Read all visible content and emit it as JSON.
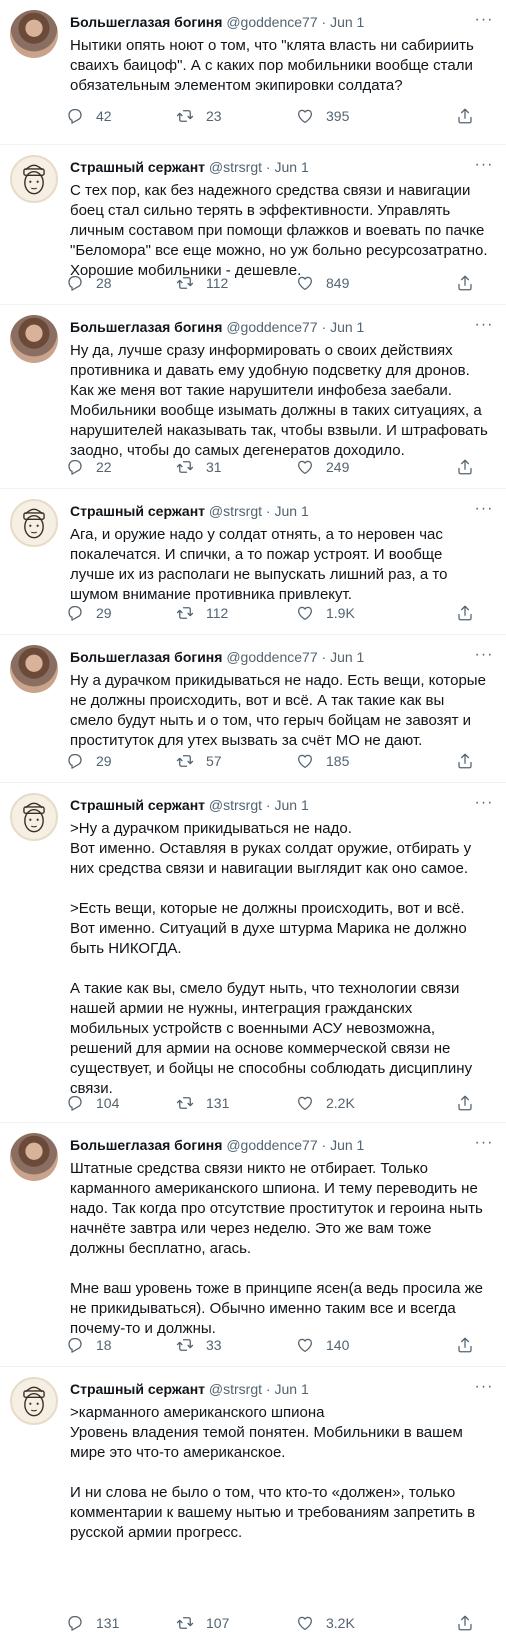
{
  "thread": {
    "tweets": [
      {
        "author": "Большеглазая богиня",
        "handle": "@goddence77",
        "separator": "·",
        "date": "Jun 1",
        "avatar": "goddess-avatar",
        "text": "Нытики опять ноют о том, что \"клята власть ни сабириить сваихъ баицоф\". А с каких пор мобильники вообще стали обязательным элементом экипировки солдата?",
        "replies": "42",
        "retweets": "23",
        "likes": "395"
      },
      {
        "author": "Страшный сержант",
        "handle": "@strsrgt",
        "separator": "·",
        "date": "Jun 1",
        "avatar": "sergeant-avatar",
        "text": "С тех пор, как без надежного средства связи и навигации боец стал сильно терять в эффективности. Управлять личным составом при помощи флажков и воевать по пачке \"Беломора\" все еще можно, но уж больно ресурсозатратно. Хорошие мобильники - дешевле.",
        "replies": "28",
        "retweets": "112",
        "likes": "849"
      },
      {
        "author": "Большеглазая богиня",
        "handle": "@goddence77",
        "separator": "·",
        "date": "Jun 1",
        "avatar": "goddess-avatar",
        "text": "Ну да, лучше сразу информировать о своих действиях противника и давать ему удобную подсветку для дронов. Как же меня вот такие нарушители инфобеза заебали. Мобильники вообще изымать должны в таких ситуациях, а нарушителей наказывать так, чтобы взвыли. И штрафовать заодно, чтобы до самых дегенератов доходило.",
        "replies": "22",
        "retweets": "31",
        "likes": "249"
      },
      {
        "author": "Страшный сержант",
        "handle": "@strsrgt",
        "separator": "·",
        "date": "Jun 1",
        "avatar": "sergeant-avatar",
        "text": "Ага, и оружие надо у солдат отнять, а то неровен час покалечатся. И спички, а то пожар устроят. И вообще лучше их из располаги не выпускать лишний раз, а то шумом внимание противника привлекут.",
        "replies": "29",
        "retweets": "112",
        "likes": "1.9K"
      },
      {
        "author": "Большеглазая богиня",
        "handle": "@goddence77",
        "separator": "·",
        "date": "Jun 1",
        "avatar": "goddess-avatar",
        "text": "Ну а дурачком прикидываться не надо. Есть вещи, которые не должны происходить, вот и всё. А так такие как вы смело будут ныть и о том, что герыч бойцам не завозят и проституток для утех вызвать за счёт МО не дают.",
        "replies": "29",
        "retweets": "57",
        "likes": "185"
      },
      {
        "author": "Страшный сержант",
        "handle": "@strsrgt",
        "separator": "·",
        "date": "Jun 1",
        "avatar": "sergeant-avatar",
        "text": ">Ну а дурачком прикидываться не надо.\nВот именно. Оставляя в руках солдат оружие, отбирать у них средства связи и навигации выглядит как оно самое.\n\n>Есть вещи, которые не должны происходить, вот и всё.\nВот именно. Ситуаций в духе штурма Марика не должно быть НИКОГДА.\n\nА такие как вы, смело будут ныть, что технологии связи нашей армии не нужны, интеграция гражданских мобильных устройств с военными АСУ невозможна, решений для армии на основе коммерческой связи не существует, и бойцы не способны соблюдать дисциплину связи.",
        "replies": "104",
        "retweets": "131",
        "likes": "2.2K"
      },
      {
        "author": "Большеглазая богиня",
        "handle": "@goddence77",
        "separator": "·",
        "date": "Jun 1",
        "avatar": "goddess-avatar",
        "text": "Штатные средства связи никто не отбирает. Только карманного американского шпиона. И тему переводить не надо. Так когда про отсутствие проституток и героина ныть начнёте завтра или через неделю. Это же вам тоже должны бесплатно, агась.\n\nМне ваш уровень тоже в принципе ясен(а ведь просила же не прикидываться). Обычно именно таким все и всегда почему-то и должны.",
        "replies": "18",
        "retweets": "33",
        "likes": "140"
      },
      {
        "author": "Страшный сержант",
        "handle": "@strsrgt",
        "separator": "·",
        "date": "Jun 1",
        "avatar": "sergeant-avatar",
        "text": ">карманного американского шпиона\nУровень владения темой понятен. Мобильники в вашем мире это что-то американское.\n\nИ ни слова не было о том, что кто-то «должен», только комментарии к вашему нытью и требованиям запретить в русской армии прогресс.",
        "replies": "131",
        "retweets": "107",
        "likes": "3.2K"
      }
    ]
  },
  "colors": {
    "text": "#0f1419",
    "secondary": "#536471",
    "divider": "#eff3f4",
    "background": "#ffffff"
  },
  "icons": [
    "more-icon",
    "reply-icon",
    "retweet-icon",
    "like-icon",
    "share-icon"
  ]
}
